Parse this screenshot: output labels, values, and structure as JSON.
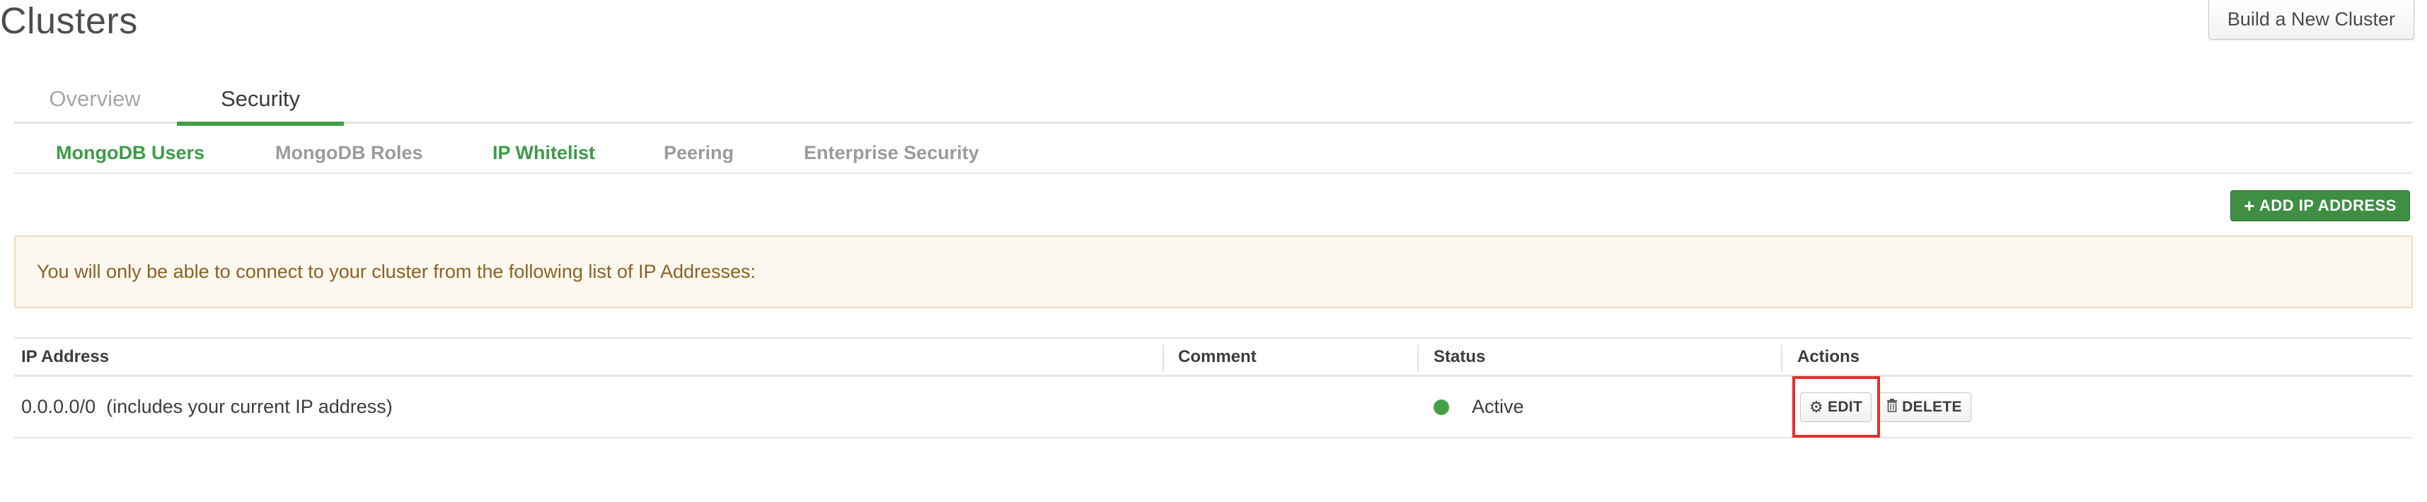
{
  "header": {
    "title": "Clusters",
    "build_button": "Build a New Cluster"
  },
  "primary_tabs": [
    {
      "label": "Overview",
      "active": false
    },
    {
      "label": "Security",
      "active": true
    }
  ],
  "secondary_tabs": [
    {
      "label": "MongoDB Users",
      "active": true
    },
    {
      "label": "MongoDB Roles",
      "active": false
    },
    {
      "label": "IP Whitelist",
      "active": true
    },
    {
      "label": "Peering",
      "active": false
    },
    {
      "label": "Enterprise Security",
      "active": false
    }
  ],
  "add_ip_button": "ADD IP ADDRESS",
  "alert": {
    "message": "You will only be able to connect to your cluster from the following list of IP Addresses:"
  },
  "table": {
    "columns": [
      "IP Address",
      "Comment",
      "Status",
      "Actions"
    ],
    "rows": [
      {
        "ip_address": "0.0.0.0/0  (includes your current IP address)",
        "comment": "",
        "status": "Active",
        "actions": {
          "edit": "EDIT",
          "delete": "DELETE"
        }
      }
    ]
  },
  "colors": {
    "accent_green": "#43a047",
    "button_green": "#3e8f44",
    "alert_background": "#fdf8ef",
    "alert_text": "#8a6223",
    "highlight_red": "#e0302a"
  },
  "icons": {
    "add": "plus-icon",
    "edit": "gear-icon",
    "delete": "trash-icon",
    "status": "status-dot-icon"
  }
}
